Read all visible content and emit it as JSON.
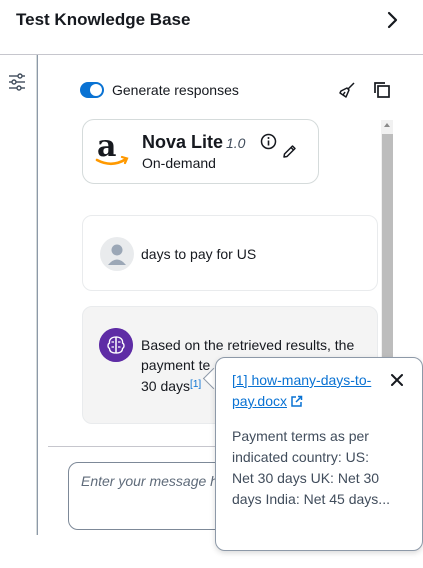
{
  "header": {
    "title": "Test Knowledge Base"
  },
  "controls": {
    "generate_label": "Generate responses"
  },
  "model": {
    "name": "Nova Lite",
    "version": "1.0",
    "mode": "On-demand"
  },
  "user_message": {
    "text": "days to pay for US"
  },
  "assistant_message": {
    "text_before": "Based on the retrieved results, the payment te",
    "text_line3": "30 days",
    "citation": "[1]"
  },
  "input": {
    "placeholder": "Enter your message h"
  },
  "popover": {
    "source_link": "[1] how-many-days-to-pay.docx",
    "excerpt": "Payment terms as per indicated country: US: Net 30 days UK: Net 30 days India: Net 45 days..."
  },
  "colors": {
    "accent": "#0972d3",
    "ai_avatar": "#5e2ca5",
    "amazon_orange": "#ff9900"
  },
  "icons": [
    "chevron-right-icon",
    "settings-sliders-icon",
    "clear-brush-icon",
    "copy-icon",
    "amazon-logo",
    "info-icon",
    "edit-pencil-icon",
    "user-avatar-icon",
    "ai-brain-icon",
    "external-link-icon",
    "close-icon"
  ]
}
